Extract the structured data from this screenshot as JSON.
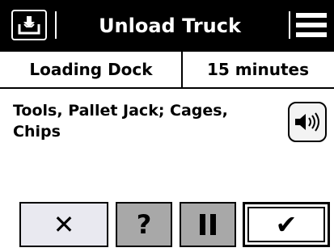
{
  "header": {
    "title": "Unload Truck",
    "left_icon": "download-tray-icon",
    "menu_icon": "hamburger-menu-icon"
  },
  "info": {
    "location": "Loading Dock",
    "duration": "15 minutes"
  },
  "task": {
    "instructions": "Tools, Pallet Jack; Cages, Chips",
    "speaker_icon": "speaker-icon"
  },
  "actions": {
    "cancel_label": "✕",
    "help_label": "?",
    "pause_icon": "pause-icon",
    "done_label": "✔"
  },
  "colors": {
    "header_bg": "#000000",
    "header_fg": "#ffffff",
    "cancel_bg": "#e9e9f0",
    "help_pause_bg": "#a8a8a8",
    "done_bg": "#ffffff"
  }
}
